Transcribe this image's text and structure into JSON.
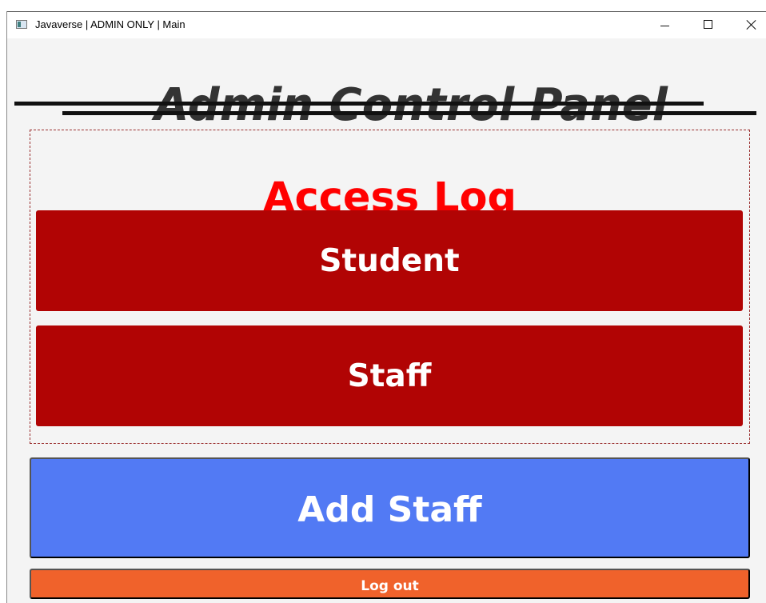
{
  "window": {
    "title": "Javaverse | ADMIN ONLY | Main",
    "icon": "app-window-icon",
    "controls": {
      "minimize_icon": "minimize-icon",
      "maximize_icon": "maximize-icon",
      "close_icon": "close-icon"
    }
  },
  "header": {
    "title": "Admin Control Panel"
  },
  "access_log": {
    "title": "Access Log",
    "buttons": [
      {
        "label": "Student"
      },
      {
        "label": "Staff"
      }
    ]
  },
  "actions": {
    "add_staff_label": "Add Staff",
    "logout_label": "Log out"
  },
  "colors": {
    "title_text": "#333333",
    "access_log_title": "#ff0000",
    "access_log_border": "#9b3030",
    "access_log_buttons": "#b10404",
    "add_staff_button": "#527af4",
    "logout_button": "#f0622b"
  }
}
